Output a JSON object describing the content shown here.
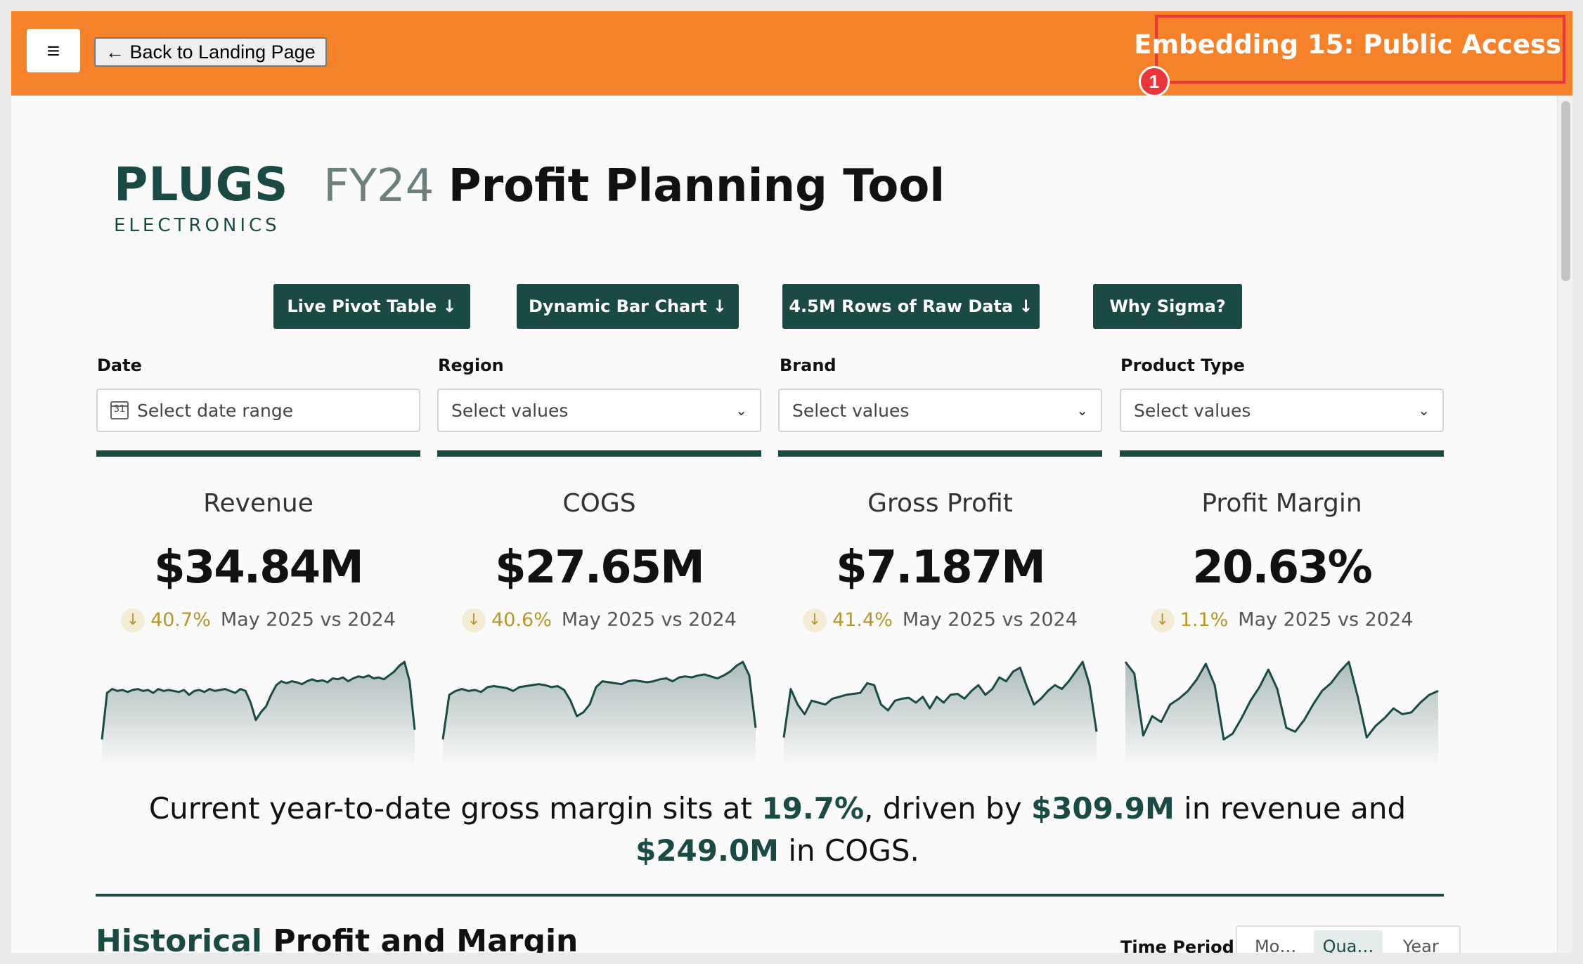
{
  "topbar": {
    "menu_icon": "≡",
    "back_label": "← Back to Landing Page",
    "embed_title": "Embedding 15: Public Access",
    "badge_number": "1",
    "color": "#f5822a"
  },
  "logo": {
    "name": "PLUGS",
    "sub": "ELECTRONICS"
  },
  "title": {
    "year": "FY24",
    "text": "Profit Planning Tool"
  },
  "nav_buttons": [
    {
      "label": "Live Pivot Table ↓"
    },
    {
      "label": "Dynamic Bar Chart ↓"
    },
    {
      "label": "4.5M Rows of Raw Data ↓"
    },
    {
      "label": "Why Sigma?"
    }
  ],
  "filters": [
    {
      "label": "Date",
      "placeholder": "Select date range",
      "icon": "calendar-icon"
    },
    {
      "label": "Region",
      "placeholder": "Select values",
      "icon": "chevron-down-icon"
    },
    {
      "label": "Brand",
      "placeholder": "Select values",
      "icon": "chevron-down-icon"
    },
    {
      "label": "Product Type",
      "placeholder": "Select values",
      "icon": "chevron-down-icon"
    }
  ],
  "kpis": [
    {
      "label": "Revenue",
      "value": "$34.84M",
      "delta": "40.7%",
      "comparison": "May 2025 vs 2024",
      "trend": [
        20,
        68,
        72,
        70,
        71,
        69,
        71,
        72,
        70,
        71,
        68,
        72,
        70,
        71,
        70,
        69,
        71,
        66,
        70,
        71,
        69,
        72,
        70,
        71,
        72,
        70,
        68,
        72,
        70,
        58,
        40,
        48,
        54,
        66,
        76,
        80,
        78,
        80,
        79,
        77,
        80,
        82,
        80,
        81,
        79,
        83,
        82,
        84,
        80,
        83,
        85,
        84,
        86,
        83,
        84,
        82,
        86,
        90,
        96,
        100,
        80,
        30
      ]
    },
    {
      "label": "COGS",
      "value": "$27.65M",
      "delta": "40.6%",
      "comparison": "May 2025 vs 2024",
      "trend": [
        20,
        66,
        70,
        72,
        70,
        71,
        69,
        74,
        75,
        74,
        73,
        70,
        74,
        75,
        76,
        77,
        76,
        74,
        75,
        71,
        60,
        44,
        48,
        56,
        74,
        80,
        79,
        78,
        77,
        80,
        81,
        80,
        79,
        80,
        82,
        83,
        80,
        84,
        85,
        84,
        86,
        87,
        85,
        83,
        86,
        90,
        96,
        100,
        86,
        32
      ]
    },
    {
      "label": "Gross Profit",
      "value": "$7.187M",
      "delta": "41.4%",
      "comparison": "May 2025 vs 2024",
      "trend": [
        22,
        72,
        56,
        46,
        60,
        58,
        56,
        62,
        64,
        66,
        67,
        68,
        78,
        76,
        56,
        50,
        60,
        62,
        63,
        58,
        64,
        52,
        64,
        58,
        66,
        67,
        62,
        70,
        76,
        66,
        72,
        84,
        80,
        90,
        94,
        74,
        56,
        62,
        70,
        76,
        72,
        80,
        90,
        100,
        76,
        28
      ]
    },
    {
      "label": "Profit Margin",
      "value": "20.63%",
      "delta": "1.1%",
      "comparison": "May 2025 vs 2024",
      "trend": [
        100,
        88,
        24,
        44,
        38,
        56,
        62,
        70,
        82,
        98,
        76,
        20,
        26,
        42,
        60,
        74,
        92,
        72,
        32,
        28,
        40,
        56,
        70,
        78,
        90,
        100,
        64,
        22,
        34,
        42,
        52,
        46,
        48,
        58,
        66,
        70
      ]
    }
  ],
  "summary": {
    "pre": "Current year-to-date gross margin sits at ",
    "margin": "19.7%",
    "mid1": ", driven by ",
    "revenue": "$309.9M",
    "mid2": " in revenue and ",
    "cogs": "$249.0M",
    "post": " in COGS."
  },
  "historical": {
    "title_a": "Historical",
    "title_b": " Profit and Margin",
    "time_period_label": "Time Period",
    "options": [
      "Mo…",
      "Qua…",
      "Year"
    ],
    "selected": "Qua…"
  },
  "colors": {
    "accent": "#1b4a45",
    "delta": "#b8962e",
    "orange": "#f5822a",
    "highlight": "#e8363a"
  }
}
